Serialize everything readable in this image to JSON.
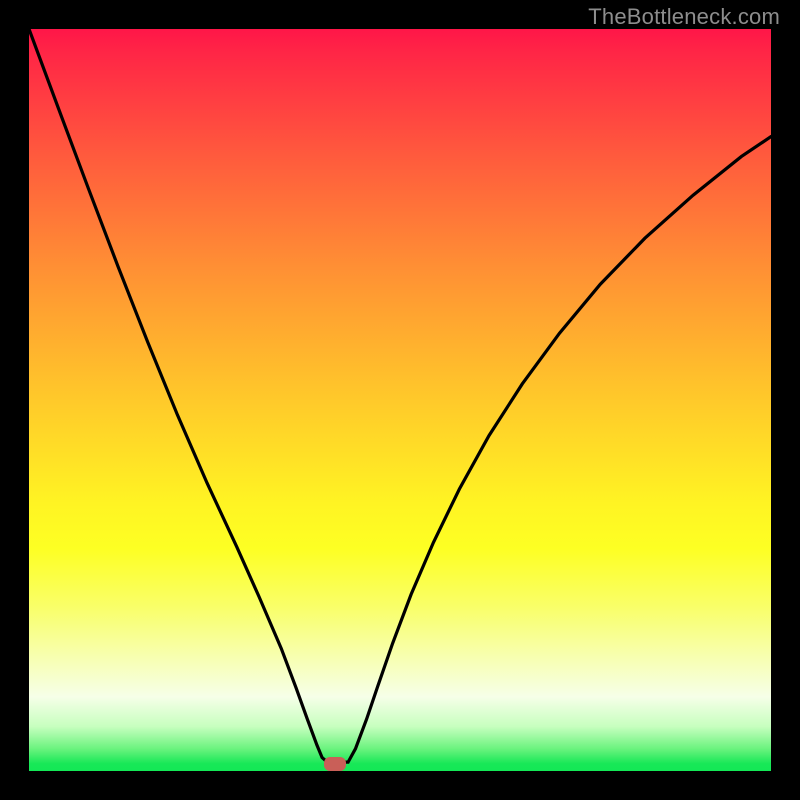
{
  "watermark": "TheBottleneck.com",
  "dot": {
    "x_frac": 0.413,
    "y_frac": 0.99
  },
  "chart_data": {
    "type": "line",
    "title": "",
    "xlabel": "",
    "ylabel": "",
    "xlim": [
      0,
      1
    ],
    "ylim": [
      0,
      1
    ],
    "grid": false,
    "legend": false,
    "note": "Coordinates are fractions of the plot area (0–1 on each axis, y measured from top). Curve is a V-shaped bottleneck profile reaching its minimum near x≈0.41.",
    "series": [
      {
        "name": "bottleneck-curve",
        "points": [
          {
            "x": 0.0,
            "y": 0.0
          },
          {
            "x": 0.04,
            "y": 0.108
          },
          {
            "x": 0.08,
            "y": 0.215
          },
          {
            "x": 0.12,
            "y": 0.32
          },
          {
            "x": 0.16,
            "y": 0.422
          },
          {
            "x": 0.2,
            "y": 0.52
          },
          {
            "x": 0.24,
            "y": 0.612
          },
          {
            "x": 0.28,
            "y": 0.698
          },
          {
            "x": 0.31,
            "y": 0.765
          },
          {
            "x": 0.34,
            "y": 0.835
          },
          {
            "x": 0.36,
            "y": 0.888
          },
          {
            "x": 0.375,
            "y": 0.93
          },
          {
            "x": 0.388,
            "y": 0.965
          },
          {
            "x": 0.395,
            "y": 0.982
          },
          {
            "x": 0.402,
            "y": 0.988
          },
          {
            "x": 0.43,
            "y": 0.988
          },
          {
            "x": 0.44,
            "y": 0.97
          },
          {
            "x": 0.455,
            "y": 0.93
          },
          {
            "x": 0.47,
            "y": 0.886
          },
          {
            "x": 0.49,
            "y": 0.828
          },
          {
            "x": 0.515,
            "y": 0.762
          },
          {
            "x": 0.545,
            "y": 0.692
          },
          {
            "x": 0.58,
            "y": 0.62
          },
          {
            "x": 0.62,
            "y": 0.548
          },
          {
            "x": 0.665,
            "y": 0.478
          },
          {
            "x": 0.715,
            "y": 0.41
          },
          {
            "x": 0.77,
            "y": 0.344
          },
          {
            "x": 0.83,
            "y": 0.282
          },
          {
            "x": 0.895,
            "y": 0.224
          },
          {
            "x": 0.96,
            "y": 0.172
          },
          {
            "x": 1.0,
            "y": 0.145
          }
        ]
      }
    ],
    "marker": {
      "x": 0.413,
      "y": 0.99,
      "color": "#c95f58"
    },
    "background_gradient": {
      "direction": "top-to-bottom",
      "stops": [
        {
          "offset": 0.0,
          "color": "#ff1648"
        },
        {
          "offset": 0.32,
          "color": "#ff8f34"
        },
        {
          "offset": 0.64,
          "color": "#fff423"
        },
        {
          "offset": 0.9,
          "color": "#f6ffe8"
        },
        {
          "offset": 1.0,
          "color": "#13e856"
        }
      ]
    }
  }
}
